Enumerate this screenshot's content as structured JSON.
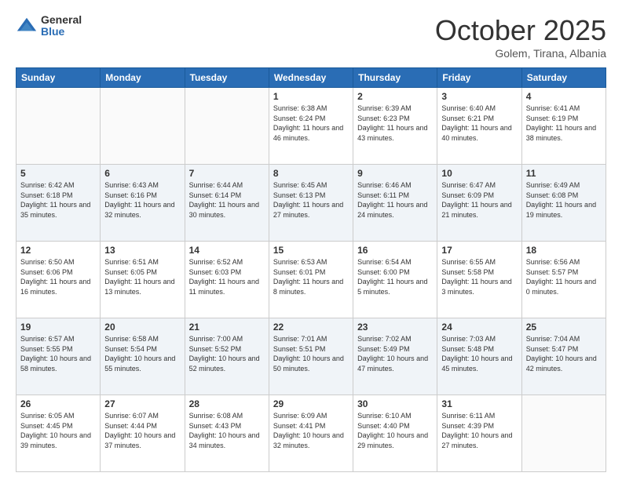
{
  "header": {
    "logo_general": "General",
    "logo_blue": "Blue",
    "title": "October 2025",
    "location": "Golem, Tirana, Albania"
  },
  "days_of_week": [
    "Sunday",
    "Monday",
    "Tuesday",
    "Wednesday",
    "Thursday",
    "Friday",
    "Saturday"
  ],
  "weeks": [
    [
      {
        "day": "",
        "info": ""
      },
      {
        "day": "",
        "info": ""
      },
      {
        "day": "",
        "info": ""
      },
      {
        "day": "1",
        "info": "Sunrise: 6:38 AM\nSunset: 6:24 PM\nDaylight: 11 hours\nand 46 minutes."
      },
      {
        "day": "2",
        "info": "Sunrise: 6:39 AM\nSunset: 6:23 PM\nDaylight: 11 hours\nand 43 minutes."
      },
      {
        "day": "3",
        "info": "Sunrise: 6:40 AM\nSunset: 6:21 PM\nDaylight: 11 hours\nand 40 minutes."
      },
      {
        "day": "4",
        "info": "Sunrise: 6:41 AM\nSunset: 6:19 PM\nDaylight: 11 hours\nand 38 minutes."
      }
    ],
    [
      {
        "day": "5",
        "info": "Sunrise: 6:42 AM\nSunset: 6:18 PM\nDaylight: 11 hours\nand 35 minutes."
      },
      {
        "day": "6",
        "info": "Sunrise: 6:43 AM\nSunset: 6:16 PM\nDaylight: 11 hours\nand 32 minutes."
      },
      {
        "day": "7",
        "info": "Sunrise: 6:44 AM\nSunset: 6:14 PM\nDaylight: 11 hours\nand 30 minutes."
      },
      {
        "day": "8",
        "info": "Sunrise: 6:45 AM\nSunset: 6:13 PM\nDaylight: 11 hours\nand 27 minutes."
      },
      {
        "day": "9",
        "info": "Sunrise: 6:46 AM\nSunset: 6:11 PM\nDaylight: 11 hours\nand 24 minutes."
      },
      {
        "day": "10",
        "info": "Sunrise: 6:47 AM\nSunset: 6:09 PM\nDaylight: 11 hours\nand 21 minutes."
      },
      {
        "day": "11",
        "info": "Sunrise: 6:49 AM\nSunset: 6:08 PM\nDaylight: 11 hours\nand 19 minutes."
      }
    ],
    [
      {
        "day": "12",
        "info": "Sunrise: 6:50 AM\nSunset: 6:06 PM\nDaylight: 11 hours\nand 16 minutes."
      },
      {
        "day": "13",
        "info": "Sunrise: 6:51 AM\nSunset: 6:05 PM\nDaylight: 11 hours\nand 13 minutes."
      },
      {
        "day": "14",
        "info": "Sunrise: 6:52 AM\nSunset: 6:03 PM\nDaylight: 11 hours\nand 11 minutes."
      },
      {
        "day": "15",
        "info": "Sunrise: 6:53 AM\nSunset: 6:01 PM\nDaylight: 11 hours\nand 8 minutes."
      },
      {
        "day": "16",
        "info": "Sunrise: 6:54 AM\nSunset: 6:00 PM\nDaylight: 11 hours\nand 5 minutes."
      },
      {
        "day": "17",
        "info": "Sunrise: 6:55 AM\nSunset: 5:58 PM\nDaylight: 11 hours\nand 3 minutes."
      },
      {
        "day": "18",
        "info": "Sunrise: 6:56 AM\nSunset: 5:57 PM\nDaylight: 11 hours\nand 0 minutes."
      }
    ],
    [
      {
        "day": "19",
        "info": "Sunrise: 6:57 AM\nSunset: 5:55 PM\nDaylight: 10 hours\nand 58 minutes."
      },
      {
        "day": "20",
        "info": "Sunrise: 6:58 AM\nSunset: 5:54 PM\nDaylight: 10 hours\nand 55 minutes."
      },
      {
        "day": "21",
        "info": "Sunrise: 7:00 AM\nSunset: 5:52 PM\nDaylight: 10 hours\nand 52 minutes."
      },
      {
        "day": "22",
        "info": "Sunrise: 7:01 AM\nSunset: 5:51 PM\nDaylight: 10 hours\nand 50 minutes."
      },
      {
        "day": "23",
        "info": "Sunrise: 7:02 AM\nSunset: 5:49 PM\nDaylight: 10 hours\nand 47 minutes."
      },
      {
        "day": "24",
        "info": "Sunrise: 7:03 AM\nSunset: 5:48 PM\nDaylight: 10 hours\nand 45 minutes."
      },
      {
        "day": "25",
        "info": "Sunrise: 7:04 AM\nSunset: 5:47 PM\nDaylight: 10 hours\nand 42 minutes."
      }
    ],
    [
      {
        "day": "26",
        "info": "Sunrise: 6:05 AM\nSunset: 4:45 PM\nDaylight: 10 hours\nand 39 minutes."
      },
      {
        "day": "27",
        "info": "Sunrise: 6:07 AM\nSunset: 4:44 PM\nDaylight: 10 hours\nand 37 minutes."
      },
      {
        "day": "28",
        "info": "Sunrise: 6:08 AM\nSunset: 4:43 PM\nDaylight: 10 hours\nand 34 minutes."
      },
      {
        "day": "29",
        "info": "Sunrise: 6:09 AM\nSunset: 4:41 PM\nDaylight: 10 hours\nand 32 minutes."
      },
      {
        "day": "30",
        "info": "Sunrise: 6:10 AM\nSunset: 4:40 PM\nDaylight: 10 hours\nand 29 minutes."
      },
      {
        "day": "31",
        "info": "Sunrise: 6:11 AM\nSunset: 4:39 PM\nDaylight: 10 hours\nand 27 minutes."
      },
      {
        "day": "",
        "info": ""
      }
    ]
  ]
}
